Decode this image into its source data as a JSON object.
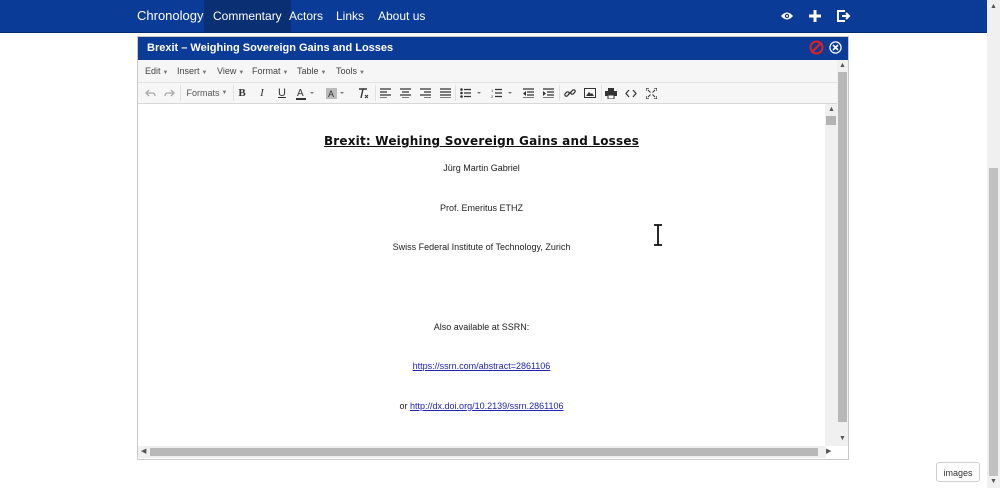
{
  "nav": {
    "brand": "Chronology",
    "links": [
      "Commentary",
      "Actors",
      "Links",
      "About us"
    ],
    "active": "Commentary",
    "icons": [
      "eye-icon",
      "plus-icon",
      "logout-icon"
    ]
  },
  "dialog": {
    "title": "Brexit – Weighing Sovereign Gains and Losses",
    "title_icons": [
      "cancel-icon",
      "close-icon"
    ]
  },
  "menu": {
    "items": [
      "Edit",
      "Insert",
      "View",
      "Format",
      "Table",
      "Tools"
    ]
  },
  "toolbar": {
    "formats_label": "Formats",
    "tools": [
      "undo-icon",
      "redo-icon",
      "formats-dropdown",
      "bold-icon",
      "italic-icon",
      "underline-icon",
      "text-color-icon",
      "background-color-icon",
      "clear-formatting-icon",
      "align-left-icon",
      "align-center-icon",
      "align-right-icon",
      "align-justify-icon",
      "bullet-list-icon",
      "numbered-list-icon",
      "outdent-icon",
      "indent-icon",
      "link-icon",
      "image-icon",
      "print-icon",
      "source-code-icon",
      "fullscreen-icon"
    ]
  },
  "document": {
    "title": "Brexit: Weighing Sovereign Gains and Losses",
    "author": "Jürg Martin Gabriel",
    "position": "Prof. Emeritus ETHZ",
    "institution": "Swiss Federal Institute of Technology, Zurich",
    "available_text": "Also available at SSRN:",
    "ssrn_link": "https://ssrn.com/abstract=2861106",
    "or_text": "or",
    "doi_link": "http://dx.doi.org/10.2139/ssrn.2861106"
  },
  "images_button": "images"
}
